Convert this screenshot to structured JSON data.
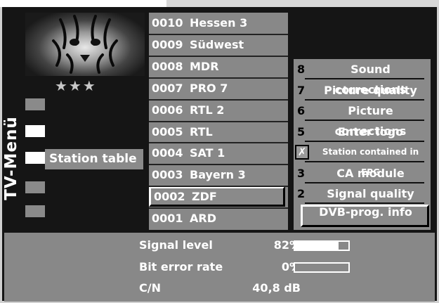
{
  "menu": {
    "title": "TV-Menü",
    "rating": "★★★"
  },
  "sidebar": {
    "active_label": "Station table"
  },
  "stations": [
    {
      "num": "0010",
      "name": "Hessen 3"
    },
    {
      "num": "0009",
      "name": "Südwest"
    },
    {
      "num": "0008",
      "name": "MDR"
    },
    {
      "num": "0007",
      "name": "PRO 7"
    },
    {
      "num": "0006",
      "name": "RTL 2"
    },
    {
      "num": "0005",
      "name": "RTL"
    },
    {
      "num": "0004",
      "name": "SAT 1"
    },
    {
      "num": "0003",
      "name": "Bayern 3"
    },
    {
      "num": "0002",
      "name": "ZDF"
    },
    {
      "num": "0001",
      "name": "ARD"
    }
  ],
  "options": [
    {
      "key": "8",
      "label": "Sound corrections"
    },
    {
      "key": "7",
      "label": "Picture quality"
    },
    {
      "key": "6",
      "label": "Picture corrections"
    },
    {
      "key": "5",
      "label": "Enter logo"
    },
    {
      "key": "✗",
      "label": "Station contained in EPG"
    },
    {
      "key": "3",
      "label": "CA module"
    },
    {
      "key": "2",
      "label": "Signal quality"
    },
    {
      "key": "",
      "label": "DVB-prog. info"
    }
  ],
  "status": {
    "signal_level_label": "Signal level",
    "signal_level_value": "82%",
    "signal_level_fraction": 0.82,
    "bit_error_label": "Bit error rate",
    "bit_error_value": "0%",
    "bit_error_fraction": 0.0,
    "cn_label": "C/N",
    "cn_value": "40,8 dB"
  }
}
